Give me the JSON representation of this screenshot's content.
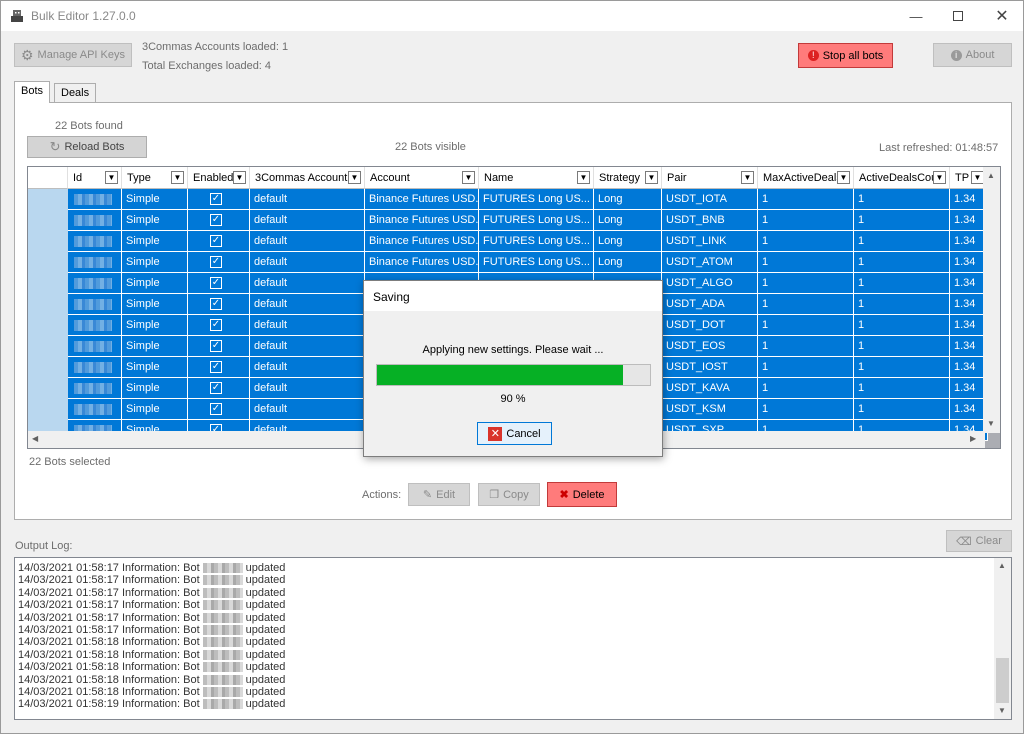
{
  "window": {
    "title": "Bulk Editor 1.27.0.0"
  },
  "toolbar": {
    "manage_api_keys": "Manage API Keys",
    "accounts_loaded": "3Commas Accounts loaded: 1",
    "exchanges_loaded": "Total Exchanges loaded: 4",
    "stop_all_bots": "Stop all bots",
    "about": "About"
  },
  "tabs": [
    {
      "label": "Bots"
    },
    {
      "label": "Deals"
    }
  ],
  "bots_tab": {
    "bots_found": "22 Bots found",
    "reload_bots": "Reload Bots",
    "bots_visible": "22 Bots visible",
    "last_refreshed": "Last refreshed: 01:48:57",
    "bots_selected": "22 Bots selected",
    "actions_label": "Actions:",
    "edit": "Edit",
    "copy": "Copy",
    "delete": "Delete"
  },
  "grid": {
    "columns": [
      "Id",
      "Type",
      "Enabled",
      "3Commas Account",
      "Account",
      "Name",
      "Strategy",
      "Pair",
      "MaxActiveDeals",
      "ActiveDealsCou",
      "TP"
    ],
    "rows": [
      {
        "type": "Simple",
        "account3c": "default",
        "account": "Binance Futures USD...",
        "name": "FUTURES Long US...",
        "strategy": "Long",
        "pair": "USDT_IOTA",
        "max": "1",
        "active": "1",
        "tp": "1.34"
      },
      {
        "type": "Simple",
        "account3c": "default",
        "account": "Binance Futures USD...",
        "name": "FUTURES Long US...",
        "strategy": "Long",
        "pair": "USDT_BNB",
        "max": "1",
        "active": "1",
        "tp": "1.34"
      },
      {
        "type": "Simple",
        "account3c": "default",
        "account": "Binance Futures USD...",
        "name": "FUTURES Long US...",
        "strategy": "Long",
        "pair": "USDT_LINK",
        "max": "1",
        "active": "1",
        "tp": "1.34"
      },
      {
        "type": "Simple",
        "account3c": "default",
        "account": "Binance Futures USD...",
        "name": "FUTURES Long US...",
        "strategy": "Long",
        "pair": "USDT_ATOM",
        "max": "1",
        "active": "1",
        "tp": "1.34"
      },
      {
        "type": "Simple",
        "account3c": "default",
        "account": "",
        "name": "",
        "strategy": "",
        "pair": "USDT_ALGO",
        "max": "1",
        "active": "1",
        "tp": "1.34"
      },
      {
        "type": "Simple",
        "account3c": "default",
        "account": "",
        "name": "",
        "strategy": "",
        "pair": "USDT_ADA",
        "max": "1",
        "active": "1",
        "tp": "1.34"
      },
      {
        "type": "Simple",
        "account3c": "default",
        "account": "",
        "name": "",
        "strategy": "",
        "pair": "USDT_DOT",
        "max": "1",
        "active": "1",
        "tp": "1.34"
      },
      {
        "type": "Simple",
        "account3c": "default",
        "account": "",
        "name": "",
        "strategy": "",
        "pair": "USDT_EOS",
        "max": "1",
        "active": "1",
        "tp": "1.34"
      },
      {
        "type": "Simple",
        "account3c": "default",
        "account": "",
        "name": "",
        "strategy": "",
        "pair": "USDT_IOST",
        "max": "1",
        "active": "1",
        "tp": "1.34"
      },
      {
        "type": "Simple",
        "account3c": "default",
        "account": "",
        "name": "",
        "strategy": "",
        "pair": "USDT_KAVA",
        "max": "1",
        "active": "1",
        "tp": "1.34"
      },
      {
        "type": "Simple",
        "account3c": "default",
        "account": "",
        "name": "",
        "strategy": "",
        "pair": "USDT_KSM",
        "max": "1",
        "active": "1",
        "tp": "1.34"
      },
      {
        "type": "Simple",
        "account3c": "default",
        "account": "",
        "name": "",
        "strategy": "",
        "pair": "USDT_SXP",
        "max": "1",
        "active": "1",
        "tp": "1.34"
      }
    ]
  },
  "dialog": {
    "title": "Saving",
    "message": "Applying new settings. Please wait ...",
    "progress_percent": 90,
    "progress_label": "90 %",
    "cancel": "Cancel"
  },
  "output": {
    "label": "Output Log:",
    "clear": "Clear",
    "lines": [
      {
        "prefix": "14/03/2021 01:58:17 Information: Bot",
        "suffix": "updated"
      },
      {
        "prefix": "14/03/2021 01:58:17 Information: Bot",
        "suffix": "updated"
      },
      {
        "prefix": "14/03/2021 01:58:17 Information: Bot",
        "suffix": "updated"
      },
      {
        "prefix": "14/03/2021 01:58:17 Information: Bot",
        "suffix": "updated"
      },
      {
        "prefix": "14/03/2021 01:58:17 Information: Bot",
        "suffix": "updated"
      },
      {
        "prefix": "14/03/2021 01:58:17 Information: Bot",
        "suffix": "updated"
      },
      {
        "prefix": "14/03/2021 01:58:18 Information: Bot",
        "suffix": "updated"
      },
      {
        "prefix": "14/03/2021 01:58:18 Information: Bot",
        "suffix": "updated"
      },
      {
        "prefix": "14/03/2021 01:58:18 Information: Bot",
        "suffix": "updated"
      },
      {
        "prefix": "14/03/2021 01:58:18 Information: Bot",
        "suffix": "updated"
      },
      {
        "prefix": "14/03/2021 01:58:18 Information: Bot",
        "suffix": "updated"
      },
      {
        "prefix": "14/03/2021 01:58:19 Information: Bot",
        "suffix": "updated"
      }
    ]
  },
  "colors": {
    "selection": "#0078d7",
    "progress": "#06b025",
    "danger": "#ff7b7b"
  }
}
